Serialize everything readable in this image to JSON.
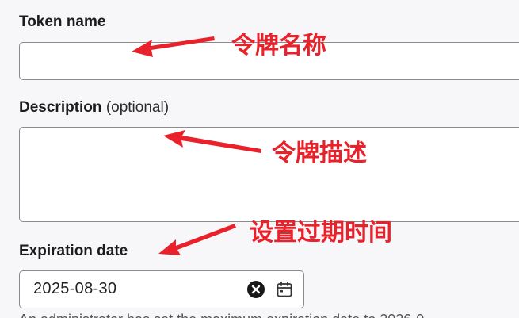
{
  "form": {
    "token_name": {
      "label": "Token name",
      "value": ""
    },
    "description": {
      "label": "Description",
      "optional_suffix": "(optional)",
      "value": ""
    },
    "expiration": {
      "label": "Expiration date",
      "value": "2025-08-30",
      "helper_text": "An administrator has set the maximum expiration date to 2026-0"
    }
  },
  "annotations": {
    "token_name_note": "令牌名称",
    "description_note": "令牌描述",
    "expiration_note": "设置过期时间",
    "color": "#e8212a"
  },
  "icons": {
    "clear": "close-circle-icon",
    "calendar": "calendar-icon"
  }
}
